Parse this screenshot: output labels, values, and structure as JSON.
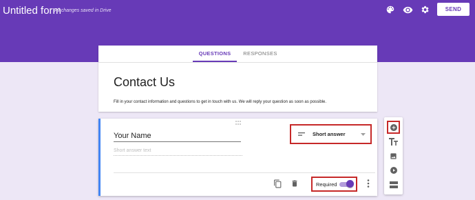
{
  "header": {
    "title": "Untitled form",
    "save_status": "All changes saved in Drive",
    "icons": [
      "palette-icon",
      "eye-icon",
      "gear-icon"
    ],
    "send_label": "SEND"
  },
  "tabs": {
    "questions": "QUESTIONS",
    "responses": "RESPONSES"
  },
  "form": {
    "title": "Contact Us",
    "description": "Fill in your contact information and questions to get in touch with us. We will reply your question as soon as possible."
  },
  "question": {
    "title": "Your Name",
    "answer_hint": "Short answer text",
    "type": "Short answer",
    "required_label": "Required",
    "required": true
  },
  "side_toolbar": [
    "add-question-icon",
    "title-text-icon",
    "image-icon",
    "video-icon",
    "section-icon"
  ],
  "colors": {
    "brand": "#673ab7",
    "background": "#ede7f6",
    "highlight": "#c62828",
    "active_question": "#4285f4"
  }
}
